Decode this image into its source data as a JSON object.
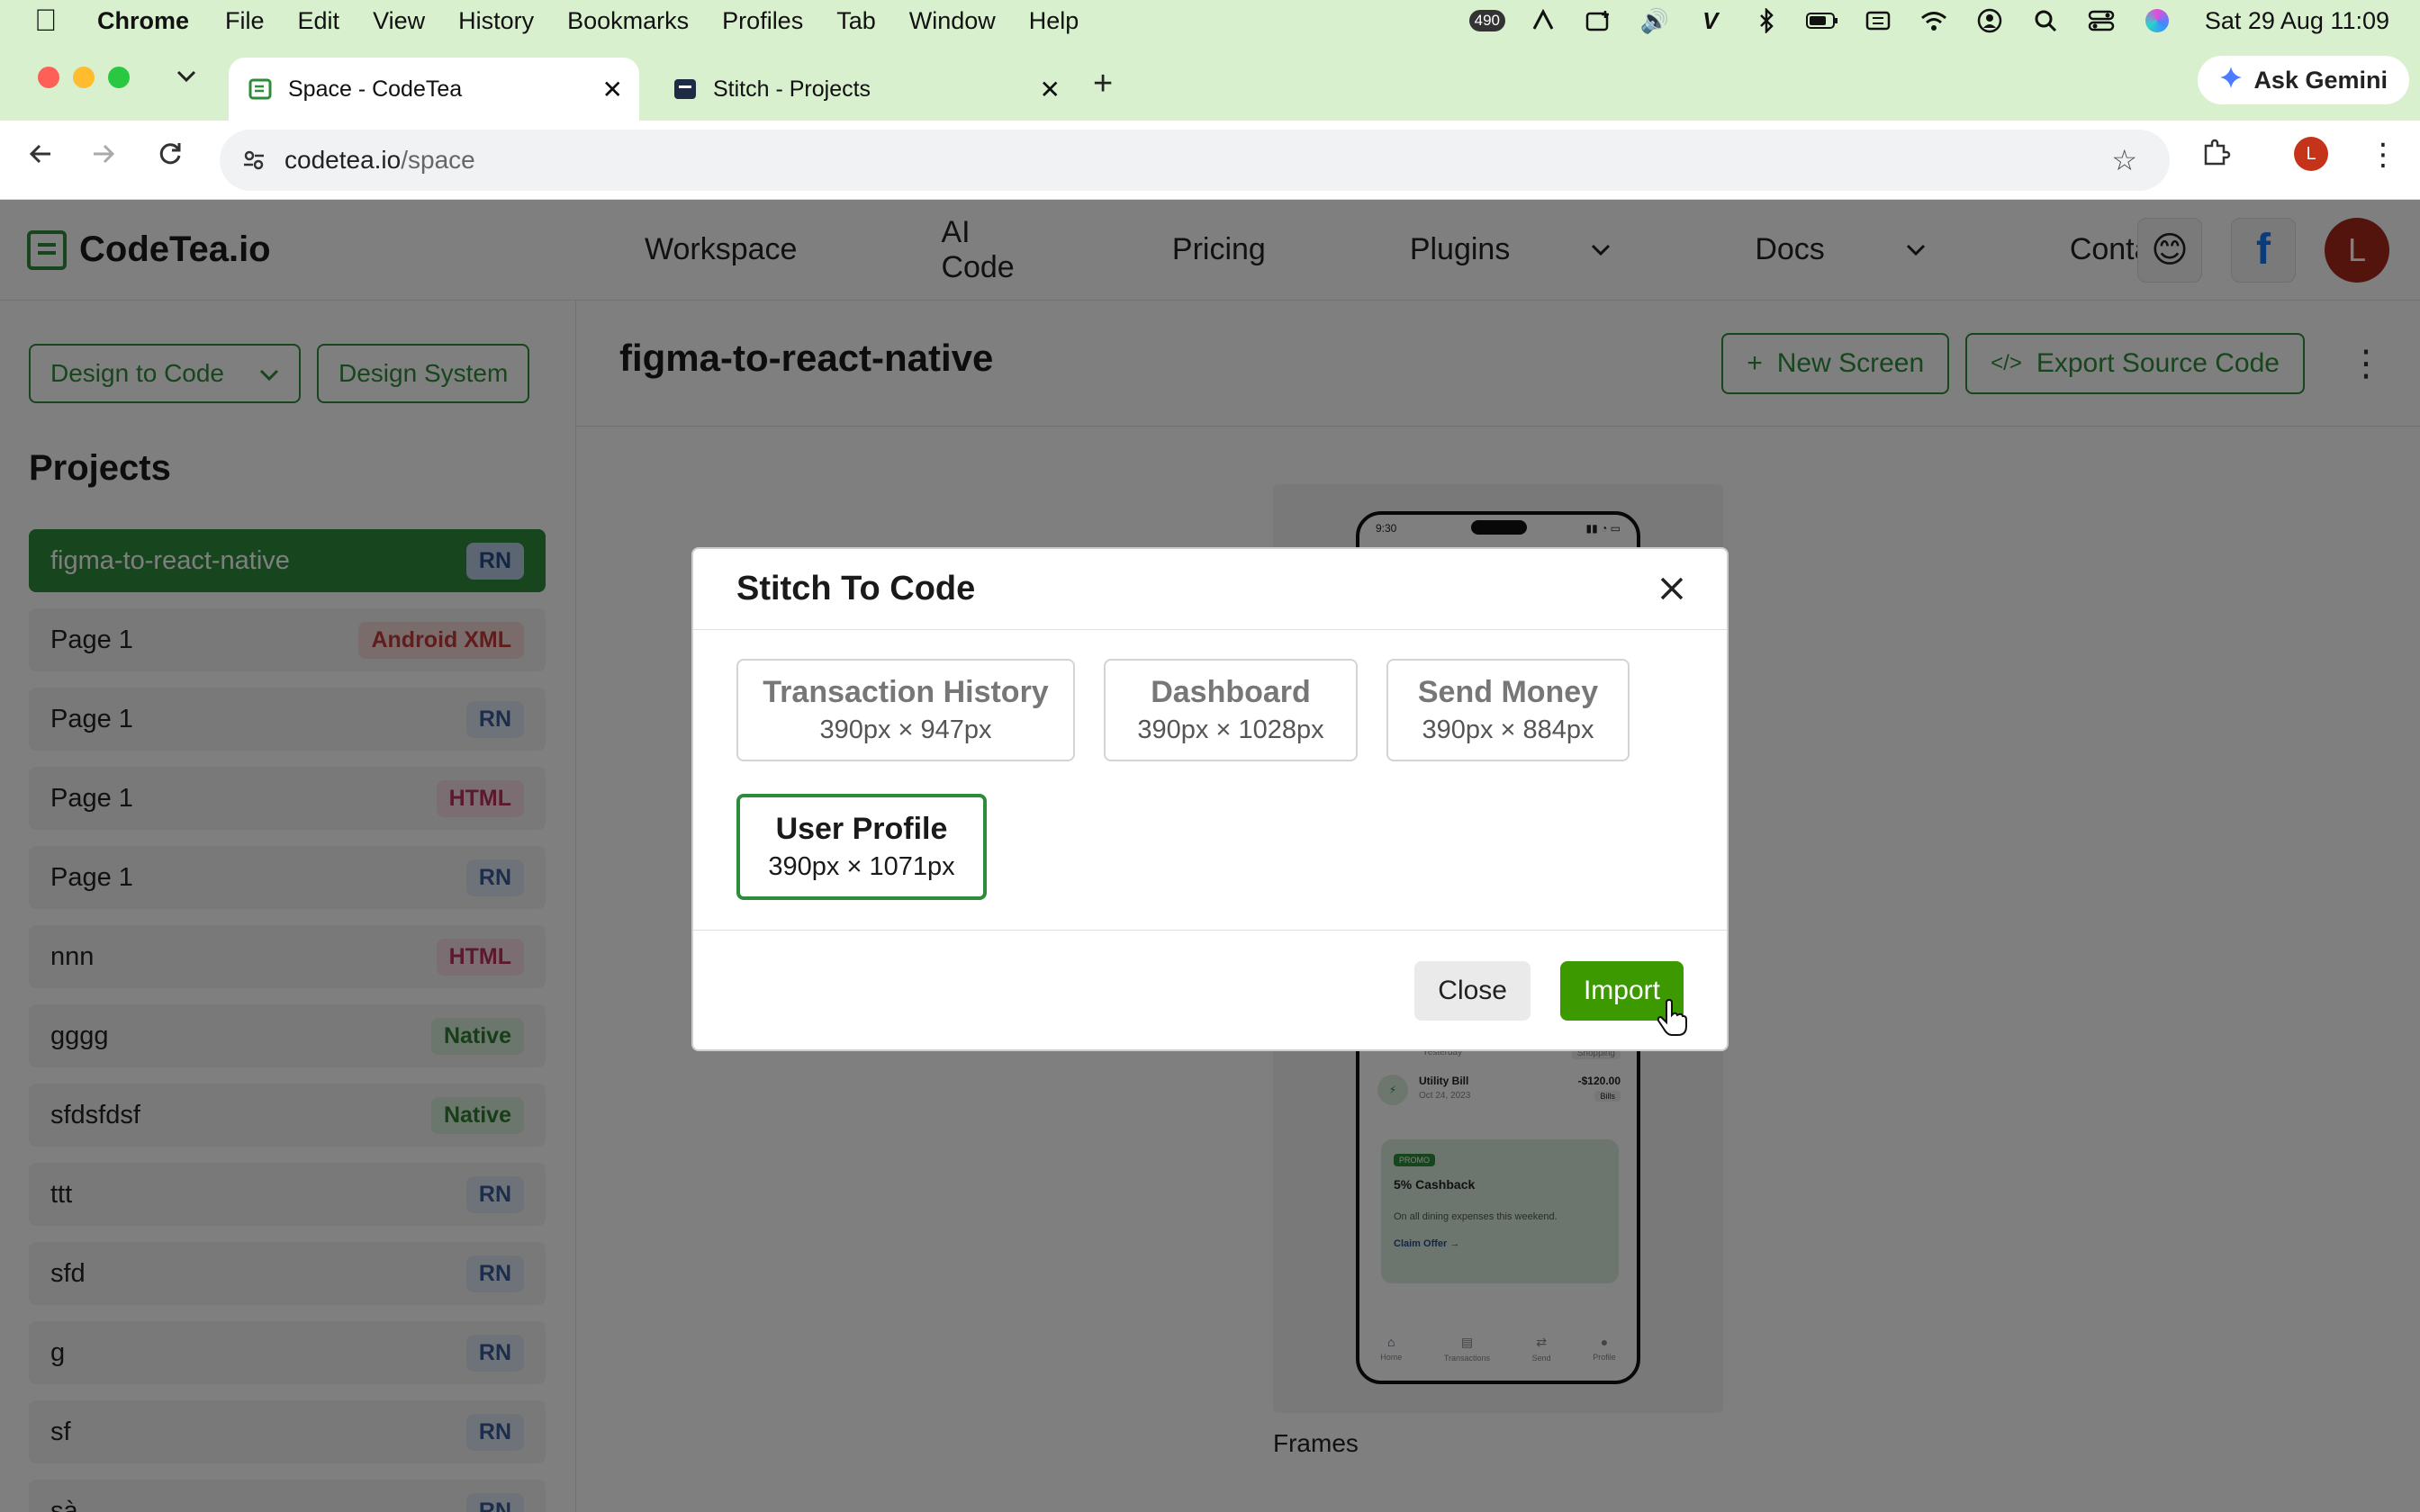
{
  "menubar": {
    "app": "Chrome",
    "menus": [
      "File",
      "Edit",
      "View",
      "History",
      "Bookmarks",
      "Profiles",
      "Tab",
      "Window",
      "Help"
    ],
    "badge": "490",
    "datetime": "Sat 29 Aug  11:09"
  },
  "tabs": [
    {
      "title": "Space - CodeTea",
      "active": true
    },
    {
      "title": "Stitch - Projects",
      "active": false
    }
  ],
  "gemini_label": "Ask Gemini",
  "address": {
    "host": "codetea.io",
    "path": "/space"
  },
  "profile_initial": "L",
  "site": {
    "logo": "CodeTea.io",
    "nav": [
      {
        "label": "Workspace",
        "dropdown": false
      },
      {
        "label": "AI Code",
        "dropdown": false
      },
      {
        "label": "Pricing",
        "dropdown": false
      },
      {
        "label": "Plugins",
        "dropdown": true
      },
      {
        "label": "Docs",
        "dropdown": true
      },
      {
        "label": "Contact",
        "dropdown": true
      }
    ],
    "fb_label": "f",
    "avatar_initial": "L"
  },
  "sidebar": {
    "mode_select": "Design to Code",
    "design_system": "Design System",
    "title": "Projects",
    "projects": [
      {
        "name": "figma-to-react-native",
        "tag": "RN",
        "active": true
      },
      {
        "name": "Page 1",
        "tag": "Android XML"
      },
      {
        "name": "Page 1",
        "tag": "RN"
      },
      {
        "name": "Page 1",
        "tag": "HTML"
      },
      {
        "name": "Page 1",
        "tag": "RN"
      },
      {
        "name": "nnn",
        "tag": "HTML"
      },
      {
        "name": "gggg",
        "tag": "Native"
      },
      {
        "name": "sfdsfdsf",
        "tag": "Native"
      },
      {
        "name": "ttt",
        "tag": "RN"
      },
      {
        "name": "sfd",
        "tag": "RN"
      },
      {
        "name": "g",
        "tag": "RN"
      },
      {
        "name": "sf",
        "tag": "RN"
      },
      {
        "name": "sà",
        "tag": "RN"
      }
    ]
  },
  "main": {
    "title": "figma-to-react-native",
    "new_screen": "New Screen",
    "export": "Export Source Code",
    "frames_label": "Frames",
    "preview": {
      "time": "9:30",
      "row1_date": "Yesterday",
      "row1_tag": "Shopping",
      "row2_name": "Utility Bill",
      "row2_date": "Oct 24, 2023",
      "row2_amount": "-$120.00",
      "row2_tag": "Bills",
      "promo_pill": "PROMO",
      "promo_title": "5% Cashback",
      "promo_desc": "On all dining expenses this weekend.",
      "promo_link": "Claim Offer →",
      "tabbar": [
        "Home",
        "Transactions",
        "Send",
        "Profile"
      ]
    }
  },
  "modal": {
    "title": "Stitch To Code",
    "screens": [
      {
        "name": "Transaction History",
        "size": "390px × 947px",
        "selected": false
      },
      {
        "name": "Dashboard",
        "size": "390px × 1028px",
        "selected": false
      },
      {
        "name": "Send Money",
        "size": "390px × 884px",
        "selected": false
      },
      {
        "name": "User Profile",
        "size": "390px × 1071px",
        "selected": true
      }
    ],
    "close_label": "Close",
    "import_label": "Import"
  },
  "colors": {
    "accent_green": "#2e8b3a",
    "import_green": "#3c9a00",
    "chrome_frame": "#d9f0cf"
  }
}
